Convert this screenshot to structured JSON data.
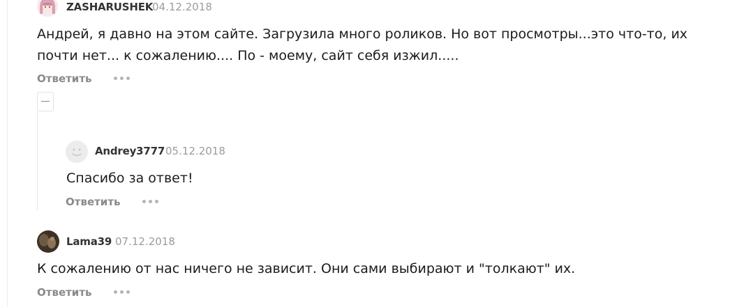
{
  "comments": [
    {
      "username": "ZASHARUSHEK",
      "date": "04.12.2018",
      "text_lines": [
        "Андрей, я давно на этом сайте. Загрузила много роликов. Но вот просмотры...это что-то, их",
        "почти нет... к сожалению.... По - моему, сайт себя изжил....."
      ],
      "reply_label": "Ответить"
    },
    {
      "username": "Andrey3777",
      "date": "05.12.2018",
      "text_lines": [
        "Спасибо за ответ!"
      ],
      "reply_label": "Ответить"
    },
    {
      "username": "Lama39",
      "date": "07.12.2018",
      "text_lines": [
        "К сожалению от нас ничего не зависит. Они сами выбирают и \"толкают\" их."
      ],
      "reply_label": "Ответить"
    }
  ],
  "icons": {
    "more": "more-dots-icon",
    "collapse": "collapse-minus-icon"
  }
}
